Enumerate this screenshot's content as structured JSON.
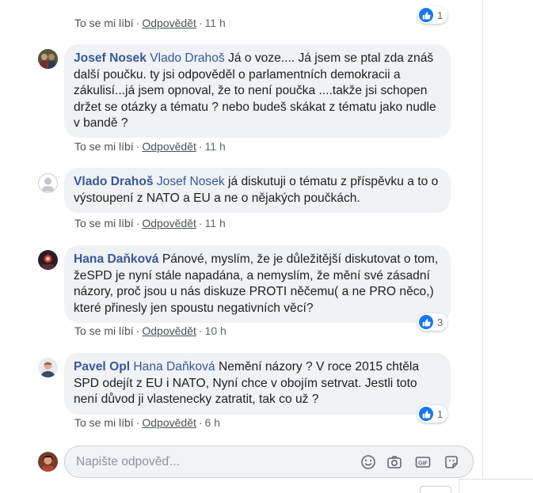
{
  "actions": {
    "like": "To se mi líbí",
    "reply": "Odpovědět",
    "sep": "·"
  },
  "comments": [
    {
      "time": "11 h",
      "reactions": "1"
    },
    {
      "author": "Josef Nosek",
      "mention": "Vlado Drahoš",
      "text": "Já o voze.... Já jsem se ptal zda znáš další poučku. ty jsi odpověděl o parlamentních demokracii a zákulisí...já jsem opnoval, že to není poučka ....takže jsi schopen držet se otázky a tématu ? nebo budeš skákat z tématu jako nudle v bandě ?",
      "time": "11 h"
    },
    {
      "author": "Vlado Drahoš",
      "mention": "Josef Nosek",
      "text": "já diskutuji o tématu z příspěvku a to o výstoupení z NATO a EU a ne o nějakých poučkách.",
      "time": "11 h"
    },
    {
      "author": "Hana Daňková",
      "mention": "",
      "text": "Pánové, myslím, že je důležitější diskutovat o tom, žeSPD je nyní stále napadána, a nemyslím, že mění své zásadní názory, proč jsou u nás diskuze PROTI něčemu( a ne PRO něco,) které přinesly jen spoustu negativních věcí?",
      "time": "10 h",
      "reactions": "3"
    },
    {
      "author": "Pavel Opl",
      "mention": "Hana Daňková",
      "text": "Nemění názory ? V roce 2015 chtěla SPD odejít z EU i NATO, Nyní chce v obojím setrvat. Jestli toto není důvod ji vlastenecky zatratit, tak co už ?",
      "time": "6 h",
      "reactions": "1"
    }
  ],
  "composer": {
    "placeholder": "Napište odpověď..."
  },
  "colors": {
    "link": "#385898",
    "bubble": "#f0f2f5",
    "like": "#1877f2"
  }
}
